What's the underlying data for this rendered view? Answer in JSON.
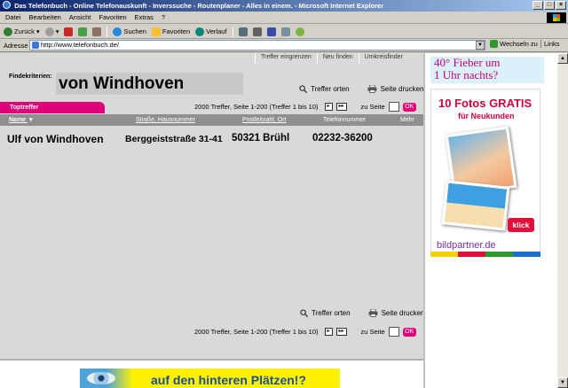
{
  "window": {
    "title": "Das Telefonbuch - Online Telefonauskunft - Inverssuche - Routenplaner - Alles in einem. - Microsoft Internet Explorer",
    "controls": {
      "minimize": "_",
      "maximize": "□",
      "close": "×"
    }
  },
  "menu": [
    "Datei",
    "Bearbeiten",
    "Ansicht",
    "Favoriten",
    "Extras",
    "?"
  ],
  "toolbar": {
    "back": "Zurück",
    "search": "Suchen",
    "favorites": "Favoriten",
    "history": "Verlauf"
  },
  "address": {
    "label": "Adresse",
    "url": "http://www.telefonbuch.de/",
    "go": "Wechseln zu",
    "links": "Links"
  },
  "page": {
    "nav_tabs": [
      "Treffer eingrenzen",
      "Neu finden",
      "Umkreisfinder"
    ],
    "criteria_label": "Findekriterien:",
    "criteria_value": "von Windhoven",
    "action_locate": "Treffer orten",
    "action_print": "Seite drucken",
    "result_tab": "Toptreffer",
    "paging_text": "2000 Treffer, Seite 1-200 (Treffer 1 bis 10)",
    "next_icon": "▸",
    "next_next_icon": "▸▸",
    "goto_label": "zu Seite",
    "ok_label": "OK",
    "columns": {
      "name": "Name",
      "street": "Straße, Hausnummer",
      "city": "Postleitzahl, Ort",
      "phone": "Telefonnummer",
      "more": "Mehr"
    },
    "results": [
      {
        "name": "Ulf von Windhoven",
        "street": "Berggeiststraße 31-41",
        "city": "50321 Brühl",
        "phone": "02232-36200"
      }
    ],
    "bottom_banner": "auf den hinteren Plätzen!?"
  },
  "ads": {
    "fieber": [
      "40° Fieber um",
      "1 Uhr nachts?"
    ],
    "gratis_title": "10 Fotos GRATIS",
    "gratis_sub": "für Neukunden",
    "klick": "klick",
    "brand": "bildpartner.de"
  },
  "colors": {
    "accent": "#e0007a",
    "titlebar": "#0a246a",
    "result_bg": "#d9d9d9"
  }
}
